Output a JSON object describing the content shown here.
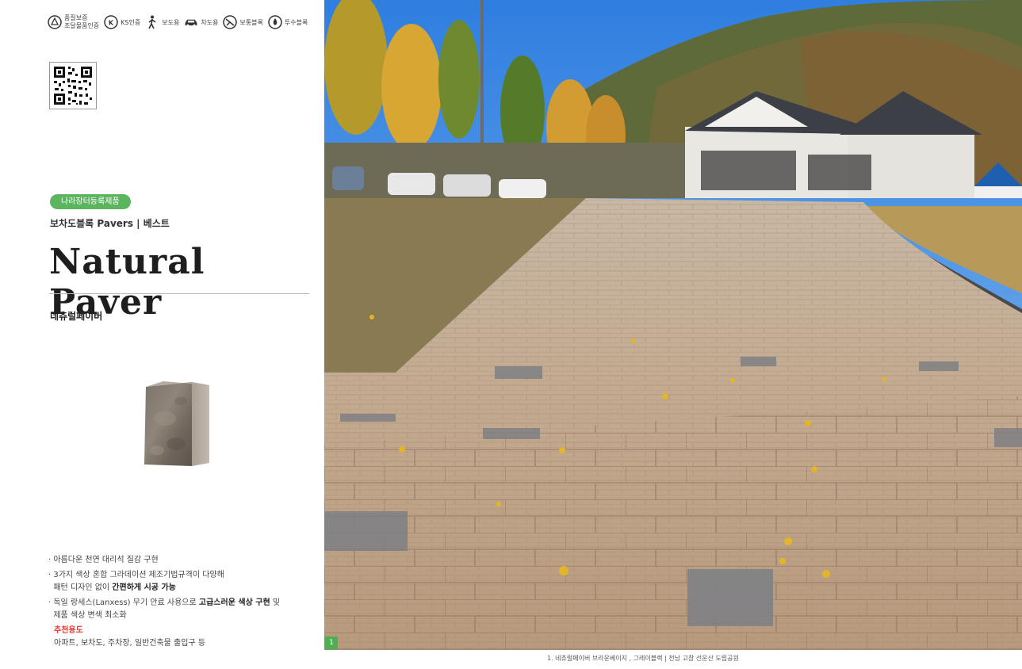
{
  "certifications": [
    {
      "icon": "quality-assurance-icon",
      "line1": "품질보증",
      "line2": "조달물품인증"
    },
    {
      "icon": "ks-mark-icon",
      "label": "KS인증"
    },
    {
      "icon": "pedestrian-icon",
      "label": "보도용"
    },
    {
      "icon": "car-icon",
      "label": "차도용"
    },
    {
      "icon": "standard-block-icon",
      "label": "보통블록"
    },
    {
      "icon": "permeable-block-icon",
      "label": "투수블록"
    }
  ],
  "badge": "나라장터등록제품",
  "subtitle": "보차도블록 Pavers | 베스트",
  "title": "Natural Paver",
  "korean_name": "네츄럴페이버",
  "features": {
    "f1": "아름다운 천연 대리석 질감 구현",
    "f2_pre": "3가지 색상 혼합 그라데이션 제조기법규격이 다양해",
    "f2_line2": "패턴 디자인 없이 ",
    "f2_bold": "간편하게 시공 가능",
    "f3_pre": "독일 랑세스(Lanxess) 무기 안료 사용으로 ",
    "f3_bold": "고급스러운 색상 구현",
    "f3_post": " 및",
    "f3_line2": "제품 색상 변색 최소화"
  },
  "recommended_label": "추천용도",
  "recommended_text": "아파트, 보차도, 주차장, 일반건축물 출입구 등",
  "photo_number": "1",
  "caption": "1. 네츄럴페이버 브라운베이지 , 그레이블랙 | 전남 고창 선운산 도립공원",
  "colors": {
    "badge": "#5bb55f",
    "accent_red": "#e23b2e",
    "number_box": "#4caf50"
  }
}
